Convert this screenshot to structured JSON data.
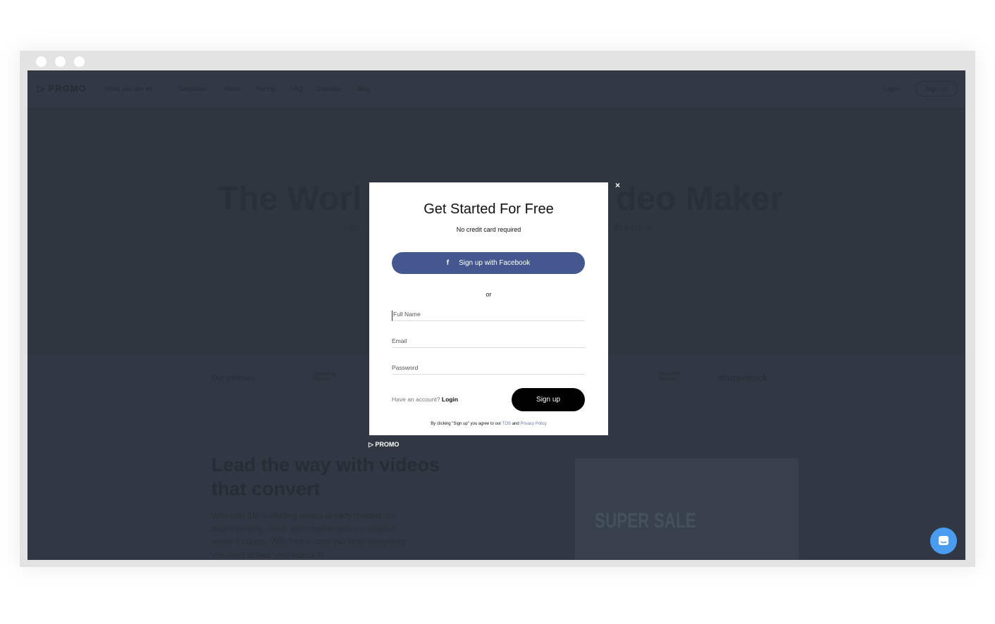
{
  "nav": {
    "logo": "PROMO",
    "items": [
      "What you can do",
      "Templates",
      "About",
      "Pricing",
      "FAQ",
      "Calendar",
      "Blog"
    ],
    "login": "Login",
    "signup": "Sign Up"
  },
  "hero": {
    "title_left": "The Worl",
    "title_right": "deo Maker",
    "sub_left": "Join",
    "sub_right": "th Videos"
  },
  "partners": {
    "label": "Our partners",
    "p1": "Marketing Partner",
    "p2": "Best B2B Product",
    "p3": "shutterstock"
  },
  "lead": {
    "title": "Lead the way with videos that convert",
    "body": "With over 2M marketing videos already created, our award winning online video maker gets you noticed where it counts. With Promo.com you have everything you need to take your videos to",
    "promo_text": "SUPER SALE"
  },
  "modal": {
    "title": "Get Started For Free",
    "subtitle": "No credit card required",
    "facebook": "Sign up with Facebook",
    "or": "or",
    "full_name": "Full Name",
    "email": "Email",
    "password": "Password",
    "have_account": "Have an account?",
    "login": "Login",
    "signup": "Sign up",
    "terms_prefix": "By clicking \"Sign up\" you agree to our",
    "tos": "TOS",
    "and": "and",
    "privacy": "Privacy Policy",
    "close": "×",
    "brand": "PROMO"
  },
  "colors": {
    "facebook": "#44588f",
    "overlay": "#313843",
    "chat": "#4a9cf0"
  }
}
